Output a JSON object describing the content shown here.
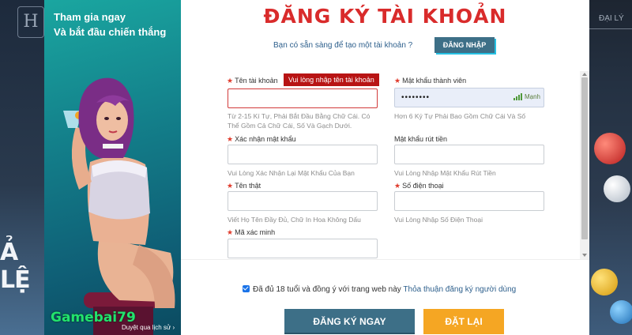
{
  "background": {
    "logo_letter": "H",
    "left_text": "Ả LỆ",
    "right_menu": "ĐẠI LÝ"
  },
  "promo": {
    "line1": "Tham gia ngay",
    "line2": "Và bắt đầu chiến thắng",
    "brand": "Gamebai79",
    "history": "Duyệt qua lịch sử ›"
  },
  "header": {
    "title": "ĐĂNG KÝ TÀI KHOẢN",
    "question": "Bạn có sẵn sàng để tạo một tài khoản ?",
    "login_button": "ĐĂNG NHẬP"
  },
  "form": {
    "username": {
      "label": "Tên tài khoản",
      "value": "",
      "error_tooltip": "Vui lòng nhập tên tài khoản",
      "hint": "Từ 2-15 Kí Tự, Phải Bắt Đầu Bằng Chữ Cái. Có Thể Gồm Cả Chữ Cái, Số Và Gạch Dưới."
    },
    "password": {
      "label": "Mật khẩu thành viên",
      "value": "••••••••",
      "strength": "Mạnh",
      "hint": "Hơn 6 Ký Tự Phải Bao Gồm Chữ Cái Và Số"
    },
    "confirm_password": {
      "label": "Xác nhận mật khẩu",
      "value": "",
      "hint": "Vui Lòng Xác Nhận Lại Mật Khẩu Của Bạn"
    },
    "withdraw_password": {
      "label": "Mật khẩu rút tiền",
      "value": "",
      "hint": "Vui Lòng Nhập Mật Khẩu Rút Tiền"
    },
    "real_name": {
      "label": "Tên thật",
      "value": "",
      "hint": "Viết Họ Tên Đầy Đủ, Chữ In Hoa Không Dấu"
    },
    "phone": {
      "label": "Số điện thoại",
      "value": "",
      "hint": "Vui Lòng Nhập Số Điện Thoại"
    },
    "captcha": {
      "label": "Mã xác minh",
      "value": ""
    }
  },
  "agreement": {
    "checked": true,
    "text": "Đã đủ 18 tuổi và đồng ý với trang web này",
    "link": "Thỏa thuận đăng ký người dùng"
  },
  "buttons": {
    "register": "ĐĂNG KÝ NGAY",
    "reset": "ĐẶT LẠI"
  },
  "colors": {
    "title_red": "#d92b2b",
    "primary_blue": "#3d6f87",
    "reset_orange": "#f5a623",
    "brand_green": "#22e36d",
    "error_red": "#b81414"
  }
}
